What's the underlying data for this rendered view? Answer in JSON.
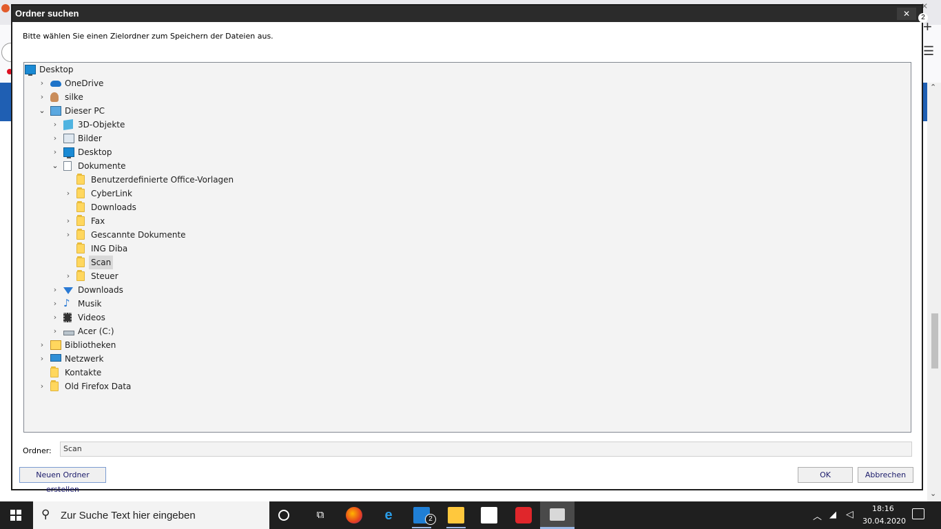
{
  "dialog": {
    "title": "Ordner suchen",
    "close_glyph": "✕",
    "instruction": "Bitte wählen Sie einen Zielordner zum Speichern der Dateien aus.",
    "folder_label": "Ordner:",
    "folder_value": "Scan",
    "new_folder_label": "Neuen Ordner erstellen",
    "ok_label": "OK",
    "cancel_label": "Abbrechen"
  },
  "tree": [
    {
      "label": "Desktop",
      "icon": "desktop-icon",
      "level": 0,
      "expander": "none"
    },
    {
      "label": "OneDrive",
      "icon": "onedrive-cloud-icon",
      "level": 1,
      "expander": "collapsed"
    },
    {
      "label": "silke",
      "icon": "user-icon",
      "level": 1,
      "expander": "collapsed"
    },
    {
      "label": "Dieser PC",
      "icon": "computer-icon",
      "level": 1,
      "expander": "expanded"
    },
    {
      "label": "3D-Objekte",
      "icon": "cube-3d-icon",
      "level": 2,
      "expander": "collapsed"
    },
    {
      "label": "Bilder",
      "icon": "pictures-icon",
      "level": 2,
      "expander": "collapsed"
    },
    {
      "label": "Desktop",
      "icon": "desktop-icon",
      "level": 2,
      "expander": "collapsed"
    },
    {
      "label": "Dokumente",
      "icon": "documents-icon",
      "level": 2,
      "expander": "expanded"
    },
    {
      "label": "Benutzerdefinierte Office-Vorlagen",
      "icon": "folder-icon",
      "level": 3,
      "expander": "none"
    },
    {
      "label": "CyberLink",
      "icon": "folder-icon",
      "level": 3,
      "expander": "collapsed"
    },
    {
      "label": "Downloads",
      "icon": "folder-icon",
      "level": 3,
      "expander": "none"
    },
    {
      "label": "Fax",
      "icon": "folder-icon",
      "level": 3,
      "expander": "collapsed"
    },
    {
      "label": "Gescannte Dokumente",
      "icon": "folder-icon",
      "level": 3,
      "expander": "collapsed"
    },
    {
      "label": "ING Diba",
      "icon": "folder-icon",
      "level": 3,
      "expander": "none"
    },
    {
      "label": "Scan",
      "icon": "folder-icon",
      "level": 3,
      "expander": "none",
      "selected": true
    },
    {
      "label": "Steuer",
      "icon": "folder-icon",
      "level": 3,
      "expander": "collapsed"
    },
    {
      "label": "Downloads",
      "icon": "download-arrow-icon",
      "level": 2,
      "expander": "collapsed"
    },
    {
      "label": "Musik",
      "icon": "music-note-icon",
      "level": 2,
      "expander": "collapsed"
    },
    {
      "label": "Videos",
      "icon": "film-icon",
      "level": 2,
      "expander": "collapsed"
    },
    {
      "label": "Acer (C:)",
      "icon": "drive-icon",
      "level": 2,
      "expander": "collapsed"
    },
    {
      "label": "Bibliotheken",
      "icon": "libraries-icon",
      "level": 1,
      "expander": "collapsed"
    },
    {
      "label": "Netzwerk",
      "icon": "network-icon",
      "level": 1,
      "expander": "collapsed"
    },
    {
      "label": "Kontakte",
      "icon": "folder-icon",
      "level": 1,
      "expander": "none"
    },
    {
      "label": "Old Firefox Data",
      "icon": "folder-icon",
      "level": 1,
      "expander": "collapsed"
    }
  ],
  "taskbar": {
    "search_placeholder": "Zur Suche Text hier eingeben",
    "time": "18:16",
    "date": "30.04.2020",
    "mail_badge": "2",
    "notification_badge": "2"
  }
}
